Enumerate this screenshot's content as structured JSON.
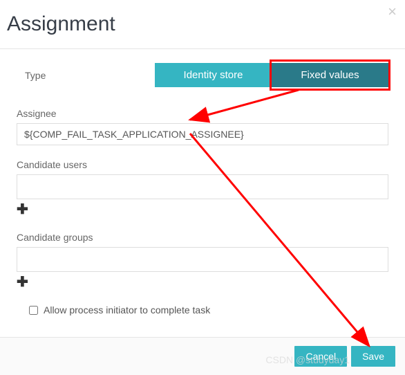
{
  "header": {
    "title": "Assignment"
  },
  "type": {
    "label": "Type",
    "identity_label": "Identity store",
    "fixed_label": "Fixed values"
  },
  "assignee": {
    "label": "Assignee",
    "value": "${COMP_FAIL_TASK_APPLICATION_ASSIGNEE}"
  },
  "candidate_users": {
    "label": "Candidate users",
    "value": ""
  },
  "candidate_groups": {
    "label": "Candidate groups",
    "value": ""
  },
  "allow_initiator": {
    "label": "Allow process initiator to complete task",
    "checked": false
  },
  "footer": {
    "cancel": "Cancel",
    "save": "Save"
  },
  "watermark": "CSDN @studyday1"
}
